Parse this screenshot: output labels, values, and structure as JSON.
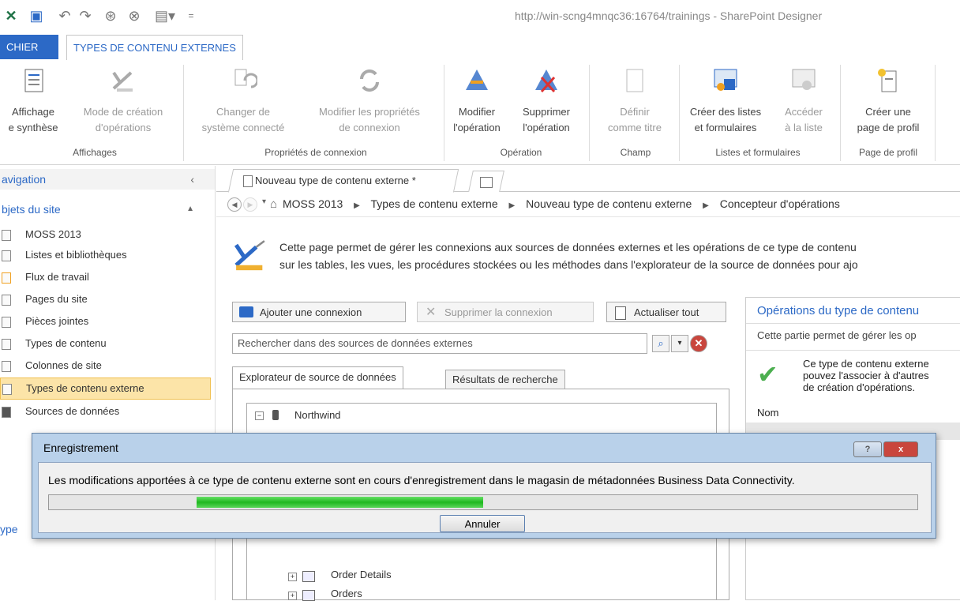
{
  "window": {
    "title": "http://win-scng4mnqc36:16764/trainings - SharePoint Designer"
  },
  "ribbon_tabs": {
    "file": "CHIER",
    "active": "TYPES DE CONTENU EXTERNES"
  },
  "ribbon": {
    "summary_view": {
      "line1": "Affichage",
      "line2": "e synthèse"
    },
    "ops_design": {
      "line1": "Mode de création",
      "line2": "d'opérations"
    },
    "change_system": {
      "line1": "Changer de",
      "line2": "système connecté"
    },
    "edit_conn_props": {
      "line1": "Modifier les propriétés",
      "line2": "de connexion"
    },
    "edit_op": {
      "line1": "Modifier",
      "line2": "l'opération"
    },
    "delete_op": {
      "line1": "Supprimer",
      "line2": "l'opération"
    },
    "set_title": {
      "line1": "Définir",
      "line2": "comme titre"
    },
    "create_lists": {
      "line1": "Créer des listes",
      "line2": "et formulaires"
    },
    "go_to_list": {
      "line1": "Accéder",
      "line2": "à la liste"
    },
    "create_profile": {
      "line1": "Créer une",
      "line2": "page de profil"
    },
    "groups": {
      "views": "Affichages",
      "conn_props": "Propriétés de connexion",
      "operation": "Opération",
      "field": "Champ",
      "lists_forms": "Listes et formulaires",
      "profile_page": "Page de profil"
    }
  },
  "nav": {
    "header": "avigation",
    "section": "bjets du site",
    "items": [
      {
        "label": "MOSS 2013",
        "selected": false
      },
      {
        "label": "Listes et bibliothèques",
        "selected": false
      },
      {
        "label": "Flux de travail",
        "selected": false
      },
      {
        "label": "Pages du site",
        "selected": false
      },
      {
        "label": "Pièces jointes",
        "selected": false
      },
      {
        "label": "Types de contenu",
        "selected": false
      },
      {
        "label": "Colonnes de site",
        "selected": false
      },
      {
        "label": "Types de contenu externe",
        "selected": true
      },
      {
        "label": "Sources de données",
        "selected": false
      }
    ],
    "footer_fragment": "ype"
  },
  "doc_tab": {
    "label": "Nouveau type de contenu externe *"
  },
  "breadcrumb": {
    "items": [
      "MOSS 2013",
      "Types de contenu externe",
      "Nouveau type de contenu externe",
      "Concepteur d'opérations"
    ],
    "separator": "▶"
  },
  "description": {
    "line1": "Cette page permet de gérer les connexions aux sources de données externes et les opérations de ce type de contenu",
    "line2": "sur les tables, les vues, les procédures stockées ou les méthodes dans l'explorateur de la source de données pour ajo"
  },
  "toolbar": {
    "add_connection": "Ajouter une connexion",
    "remove_connection": "Supprimer la connexion",
    "refresh_all": "Actualiser tout"
  },
  "search": {
    "placeholder": "Rechercher dans des sources de données externes"
  },
  "content_tabs": {
    "explorer": "Explorateur de source de données",
    "results": "Résultats de recherche"
  },
  "tree": {
    "root": "Northwind",
    "items": [
      "Order Details",
      "Orders"
    ]
  },
  "right_panel": {
    "title": "Opérations du type de contenu",
    "subtitle": "Cette partie permet de gérer les op",
    "msg_line1": "Ce type de contenu externe",
    "msg_line2": "pouvez l'associer à d'autres",
    "msg_line3": "de création d'opérations.",
    "col_name": "Nom"
  },
  "dialog": {
    "title": "Enregistrement",
    "message": "Les modifications apportées à ce type de contenu externe sont en cours d'enregistrement dans le magasin de métadonnées Business Data Connectivity.",
    "progress": 0.33,
    "cancel": "Annuler",
    "help": "?",
    "close": "x"
  },
  "colors": {
    "accent": "#2c69c6",
    "selected_nav": "#fce4a8",
    "dialog_frame": "#b9d1ea",
    "progress_green": "#1fb81f",
    "close_red": "#c9463d"
  }
}
